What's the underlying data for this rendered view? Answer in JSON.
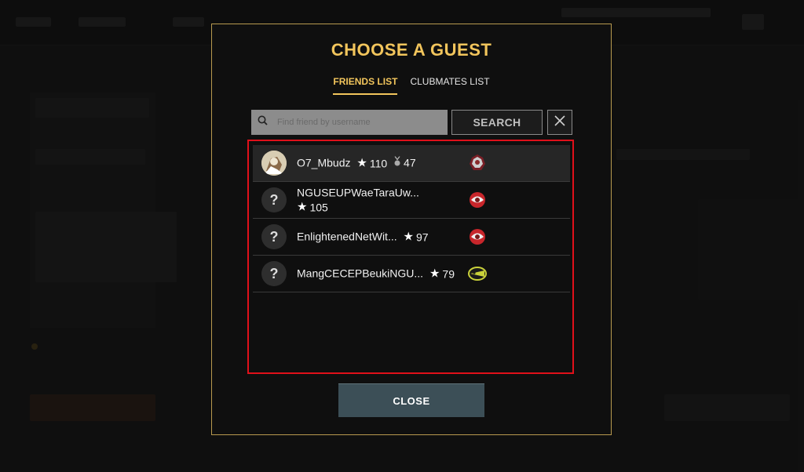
{
  "modal": {
    "title": "CHOOSE A GUEST",
    "tabs": [
      {
        "label": "FRIENDS LIST",
        "active": true
      },
      {
        "label": "CLUBMATES LIST",
        "active": false
      }
    ],
    "search": {
      "placeholder": "Find friend by username",
      "value": "",
      "button_label": "SEARCH"
    },
    "friends": [
      {
        "username": "O7_Mbudz",
        "stars": "110",
        "medal": "47",
        "avatar": "photo",
        "club_color": "#c0c0c0"
      },
      {
        "username": "NGUSEUPWaeTaraUw...",
        "stars": "105",
        "avatar": "?",
        "club_color": "#d42a2a"
      },
      {
        "username": "EnlightenedNetWit...",
        "stars": "97",
        "avatar": "?",
        "club_color": "#d42a2a"
      },
      {
        "username": "MangCECEPBeukiNGU...",
        "stars": "79",
        "avatar": "?",
        "club_color": "#c9d13a"
      }
    ],
    "close_label": "CLOSE"
  },
  "colors": {
    "accent_gold": "#f2c55c",
    "border_gold": "#b89a4f",
    "highlight_red": "#e0101a",
    "close_button": "#3c4f57"
  }
}
